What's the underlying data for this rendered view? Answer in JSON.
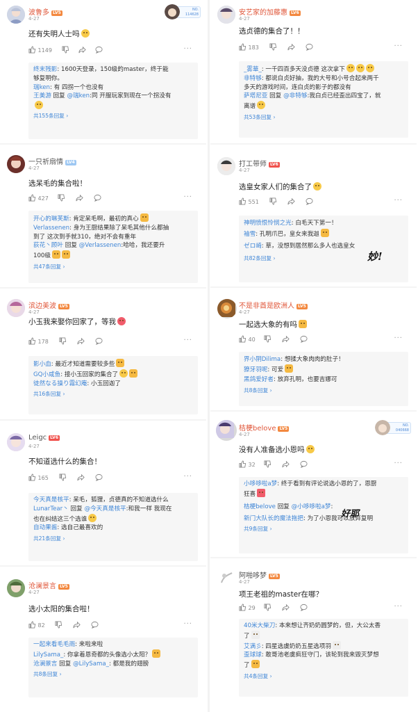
{
  "common": {
    "date": "4-27",
    "reply_word": "回复",
    "more": "···"
  },
  "left": [
    {
      "name": "波鲁多",
      "level": "LV5",
      "badge": "NO. 114628",
      "text": "还有失明人士吗",
      "likes": "1149",
      "replies": [
        {
          "user": "终末残影",
          "text": ": 1600天登录，150级的master，终于能"
        },
        {
          "user": "",
          "text": "够复明你。"
        },
        {
          "user": "瑞ken",
          "text": ": 有  四拐一个也没有"
        },
        {
          "user": "王美游",
          "reply": "回复",
          "to": "@瑞ken",
          "text": ":同 开服玩家到现在一个拐没有"
        }
      ],
      "total": "共155条回复"
    },
    {
      "name": "一只祈扇情",
      "level": "LV4",
      "text": "选呆毛的集合啦！",
      "likes": "427",
      "replies": [
        {
          "user": "开心的琳芙斯",
          "text": ": 肯定呆毛啊，最初的真心"
        },
        {
          "user": "Verlassenen",
          "text": ": 身为王厨结果除了呆毛其他什么都抽"
        },
        {
          "user": "",
          "text": "到了  这次到手就310，绝对不会有重年"
        },
        {
          "user": "荻花丶顾叶",
          "reply": "回复",
          "to": "@Verlassenen",
          "text": ":哈哈，我还要升"
        },
        {
          "user": "",
          "text": "100级"
        }
      ],
      "total": "共47条回复"
    },
    {
      "name": "滨边美波",
      "level": "LV5",
      "text": "小玉我来娶你回家了，等我",
      "likes": "178",
      "replies": [
        {
          "user": "影小血",
          "text": ": 最近才知道需要较多些"
        },
        {
          "user": "GQ小咸鱼",
          "text": ": 接小玉回家的集合了"
        },
        {
          "user": "徒然なる操り霧幻庵",
          "text": ": 小玉回迦了"
        }
      ],
      "total": "共16条回复"
    },
    {
      "name": "Leigc",
      "level": "LV6",
      "text": "不知道选什么的集合！",
      "likes": "165",
      "replies": [
        {
          "user": "今天真是核平",
          "text": ": 呆毛，狐狸，贞德真的不知道选什么"
        },
        {
          "user": "LunarTear丶",
          "reply": "回复",
          "to": "@今天真是核平",
          "text": ":和我一样 我现在"
        },
        {
          "user": "",
          "text": "也在纠结这三个选谁"
        },
        {
          "user": "自动果酱",
          "text": ": 选自己最喜欢的"
        }
      ],
      "total": "共21条回复"
    },
    {
      "name": "沧澜景言",
      "level": "LV5",
      "text": "选小太阳的集合啦！",
      "likes": "82",
      "replies": [
        {
          "user": "一起来看毛毛雨",
          "text": ": 来啦来啦"
        },
        {
          "user": "LilySama_",
          "text": ": 你拿着恩奇都的头像选小太阳？"
        },
        {
          "user": "沧澜景言",
          "reply": "回复",
          "to": "@LilySama_",
          "text": ":  都是我的翅膀"
        }
      ],
      "total": "共8条回复"
    }
  ],
  "right": [
    {
      "name": "安艺家的加藤惠",
      "level": "LV6",
      "text": "选贞德的集合了！！",
      "likes": "183",
      "replies": [
        {
          "user": "_雾華_",
          "text": ": 一千四百多天没贞德 这次拿下"
        },
        {
          "user": "非特够",
          "text": ": 都说白贞好抽，我的大号和小号合起来两千"
        },
        {
          "user": "",
          "text": "多天的游戏时间，连白贞的影子的都没有"
        },
        {
          "user": "萨塔尼亚",
          "reply": "回复",
          "to": "@非特够",
          "text": ":我白贞已经歪出四宝了，就"
        },
        {
          "user": "",
          "text": "离谱"
        }
      ],
      "total": "共53条回复"
    },
    {
      "name": "打工带师",
      "level": "LV6",
      "text": "选皇女家人们的集合了",
      "likes": "551",
      "replies": [
        {
          "user": "神明愤恨怜悯之光",
          "text": ": 白毛天下第一！"
        },
        {
          "user": "袖雪",
          "text": ": 孔明爪巴，皇女来我迦"
        },
        {
          "user": "ゼロ崎",
          "text": ": 草，没想到居然那么多人也选皇女"
        }
      ],
      "total": "共82条回复",
      "sticker": "妙!"
    },
    {
      "name": "不是非酋是欧洲人",
      "level": "LV5",
      "text": "一起选大象的有吗",
      "likes": "40",
      "replies": [
        {
          "user": "界小阴Dilima",
          "text": ": 想揉大象肉肉的肚子！"
        },
        {
          "user": "獠牙羽呢",
          "text": ": 可爱"
        },
        {
          "user": "黑鸽爱好者",
          "text": ": 放弃孔明，也要吉娜可"
        }
      ],
      "total": "共8条回复"
    },
    {
      "name": "桔梗belove",
      "level": "LV5",
      "badge": "NO. 040668",
      "text": "没有人准备选小恩吗",
      "likes": "32",
      "replies": [
        {
          "user": "小哆哆啦a梦",
          "text": ": 终于看到有评论说选小恩的了，恩厨"
        },
        {
          "user": "",
          "text": "狂喜"
        },
        {
          "user": "桔梗belove",
          "reply": "回复",
          "to": "@小哆哆啦a梦",
          "text": ":"
        },
        {
          "user": "新门大队长的魔法拖把",
          "text": ": 为了小恩我可以放弃复明"
        }
      ],
      "total": "共9条回复",
      "sticker": "好耶"
    },
    {
      "name": "阿啪哆梦",
      "level": "LV5",
      "text": "项王老祖的master在哪？",
      "likes": "29",
      "replies": [
        {
          "user": "40米大柴刀",
          "text": ": 本来想让齐奶奶圆梦的，但，大公太香"
        },
        {
          "user": "",
          "text": "了"
        },
        {
          "user": "艾满彡",
          "text": ": 四星选虞奶奶五星选项羽"
        },
        {
          "user": "歪球球",
          "text": ": 敢哥池老虞疯狂守门，该轮到我来毁灭梦想"
        },
        {
          "user": "",
          "text": "了"
        }
      ],
      "total": "共4条回复"
    }
  ]
}
